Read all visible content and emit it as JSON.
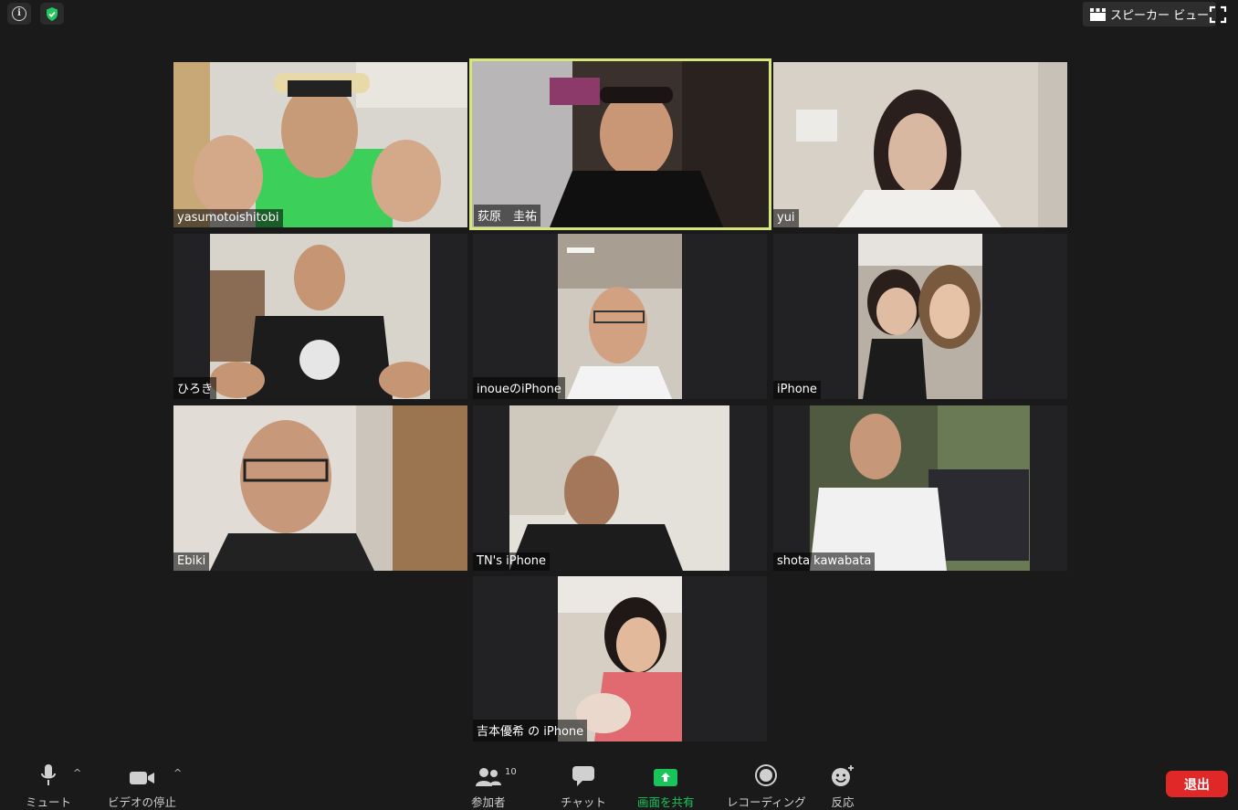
{
  "top_bar": {
    "info_icon": "info-icon",
    "security_icon": "shield-check-icon",
    "view_toggle_label": "スピーカー ビュー",
    "fullscreen_icon": "fullscreen-icon"
  },
  "participants": [
    {
      "name": "yasumotoishitobi",
      "active_speaker": false
    },
    {
      "name": "荻原　圭祐",
      "active_speaker": true
    },
    {
      "name": "yui",
      "active_speaker": false
    },
    {
      "name": "ひろき",
      "active_speaker": false
    },
    {
      "name": "inoueのiPhone",
      "active_speaker": false
    },
    {
      "name": "iPhone",
      "active_speaker": false
    },
    {
      "name": "Ebiki",
      "active_speaker": false
    },
    {
      "name": "TN's iPhone",
      "active_speaker": false
    },
    {
      "name": "shota kawabata",
      "active_speaker": false
    },
    {
      "name": "吉本優希 の iPhone",
      "active_speaker": false
    }
  ],
  "toolbar": {
    "mute_label": "ミュート",
    "video_label": "ビデオの停止",
    "participants_label": "参加者",
    "participants_count": "10",
    "chat_label": "チャット",
    "share_label": "画面を共有",
    "record_label": "レコーディング",
    "reactions_label": "反応",
    "leave_label": "退出"
  },
  "colors": {
    "background": "#1a1a1a",
    "active_border": "#d7e57a",
    "share_green": "#19c45a",
    "leave_red": "#e02828"
  }
}
